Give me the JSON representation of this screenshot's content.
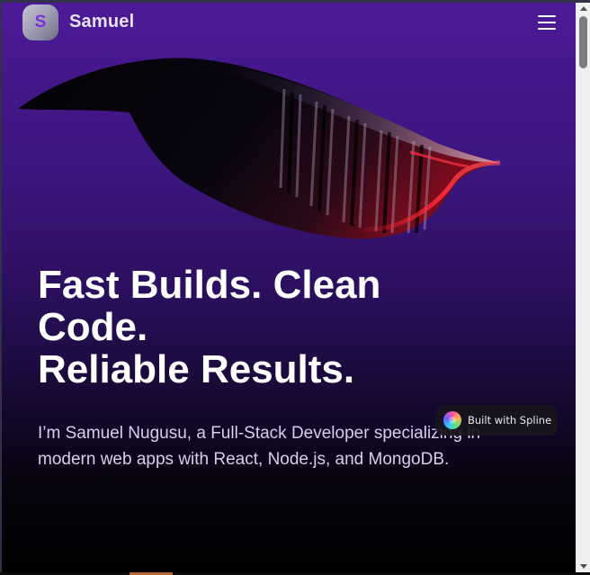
{
  "header": {
    "logo_letter": "S",
    "brand_name": "Samuel",
    "menu_icon": "hamburger-menu-icon"
  },
  "hero": {
    "title_line_1": "Fast Builds. Clean",
    "title_line_2": "Code.",
    "title_line_3": "Reliable Results.",
    "subtitle": "I’m Samuel Nugusu, a Full-Stack Developer specializing in modern web apps with React, Node.js, and MongoDB."
  },
  "spline_badge": {
    "label": "Built with Spline",
    "icon": "spline-logo-icon"
  },
  "colors": {
    "background_top": "#4c1a98",
    "background_bottom": "#000000",
    "logo_letter": "#7a2fdc",
    "subtitle_text": "#d9cdf0"
  }
}
